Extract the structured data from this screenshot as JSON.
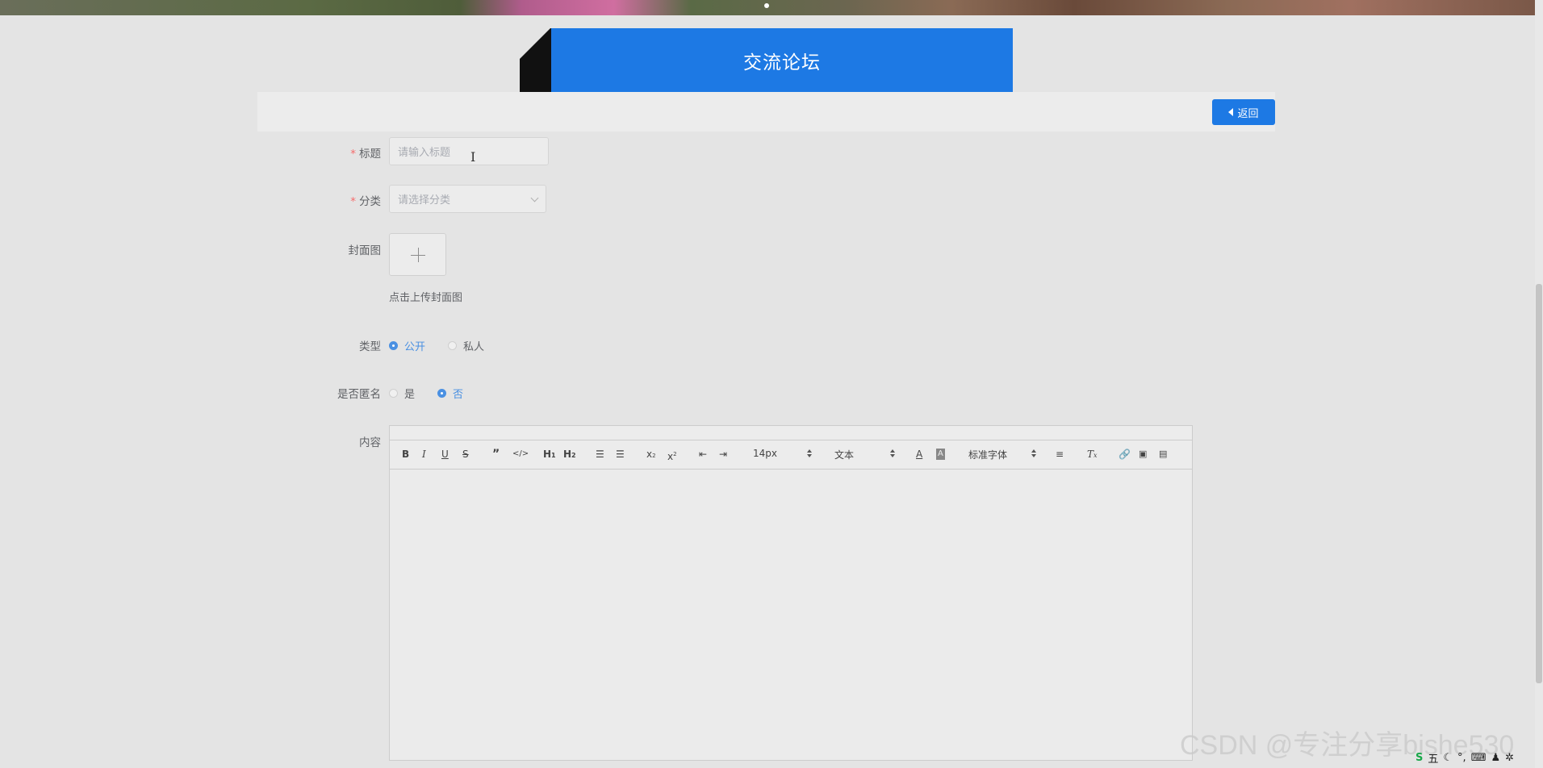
{
  "page_title": "交流论坛",
  "back_button": "返回",
  "form": {
    "title": {
      "label": "标题",
      "placeholder": "请输入标题"
    },
    "category": {
      "label": "分类",
      "placeholder": "请选择分类"
    },
    "cover": {
      "label": "封面图",
      "hint": "点击上传封面图"
    },
    "type": {
      "label": "类型",
      "options": [
        "公开",
        "私人"
      ],
      "selected": "公开"
    },
    "anonymous": {
      "label": "是否匿名",
      "options": [
        "是",
        "否"
      ],
      "selected": "否"
    },
    "content": {
      "label": "内容"
    }
  },
  "editor": {
    "font_size": "14px",
    "header_select": "文本",
    "font_family": "标准字体"
  },
  "watermark": "CSDN @专注分享bishe530",
  "tray": {
    "ime": "五"
  },
  "colors": {
    "accent": "#1d79e4",
    "radio_active": "#4a90e2",
    "required": "#f56c6c"
  }
}
